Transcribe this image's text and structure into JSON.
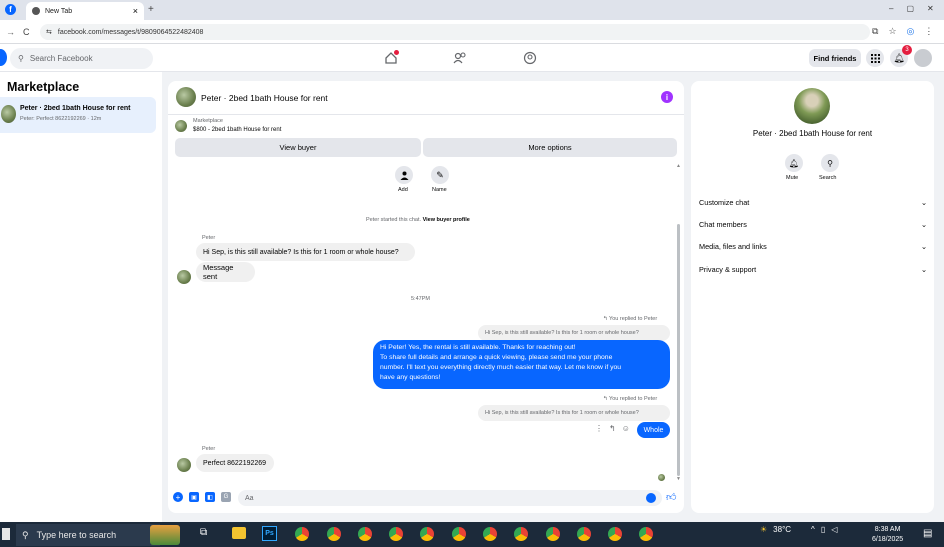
{
  "browser": {
    "tab_title": "New Tab",
    "tab_close": "×",
    "new_tab": "+",
    "url": "facebook.com/messages/t/9809064522482408"
  },
  "header": {
    "search_placeholder": "Search Facebook",
    "find_friends": "Find friends",
    "notif_count": "3"
  },
  "sidebar": {
    "title": "Marketplace",
    "conversation": {
      "name": "Peter · 2bed 1bath House for rent",
      "preview": "Peter: Perfect 8622192269 · 12m"
    }
  },
  "chat": {
    "title": "Peter · 2bed 1bath House for rent",
    "info_label": "i",
    "marketplace_label": "Marketplace",
    "listing": "$800 - 2bed 1bath House for rent",
    "view_buyer": "View buyer",
    "more_options": "More options",
    "actions": [
      {
        "label": "Add",
        "icon": "add-person-icon"
      },
      {
        "label": "Name",
        "icon": "pencil-icon"
      }
    ],
    "started_text": "Peter started this chat.",
    "view_profile_link": "View buyer profile",
    "sender_name_1": "Peter",
    "msg_1": "Hi Sep, is this still available? Is this for 1 room or whole house?",
    "msg_2": "Message sent",
    "timestamp": "5:47PM",
    "replied_label_1": "You replied to Peter",
    "quoted_1": "Hi Sep, is this still available? Is this for 1 room or whole house?",
    "my_message": [
      "Hi Peter! Yes, the rental is still available. Thanks for reaching out!",
      "To share full details and arrange a quick viewing, please send me your phone",
      "number. I'll text you everything directly much easier that way. Let me know if you",
      "have any questions!"
    ],
    "replied_label_2": "You replied to Peter",
    "quoted_2": "Hi Sep, is this still available? Is this for 1 room or whole house?",
    "whole_reply": "Whole",
    "sender_name_2": "Peter",
    "msg_3": "Perfect 8622192269",
    "composer_placeholder": "Aa"
  },
  "right_panel": {
    "title": "Peter · 2bed 1bath House for rent",
    "mute": "Mute",
    "search": "Search",
    "sections": [
      "Customize chat",
      "Chat members",
      "Media, files and links",
      "Privacy & support"
    ]
  },
  "taskbar": {
    "search_placeholder": "Type here to search",
    "temperature": "38°C",
    "time": "8:38 AM",
    "date": "6/18/2025",
    "ps_label": "Ps"
  },
  "colors": {
    "accent": "#0866ff",
    "background": "#f0f2f5",
    "taskbar": "#1c2a3a"
  }
}
